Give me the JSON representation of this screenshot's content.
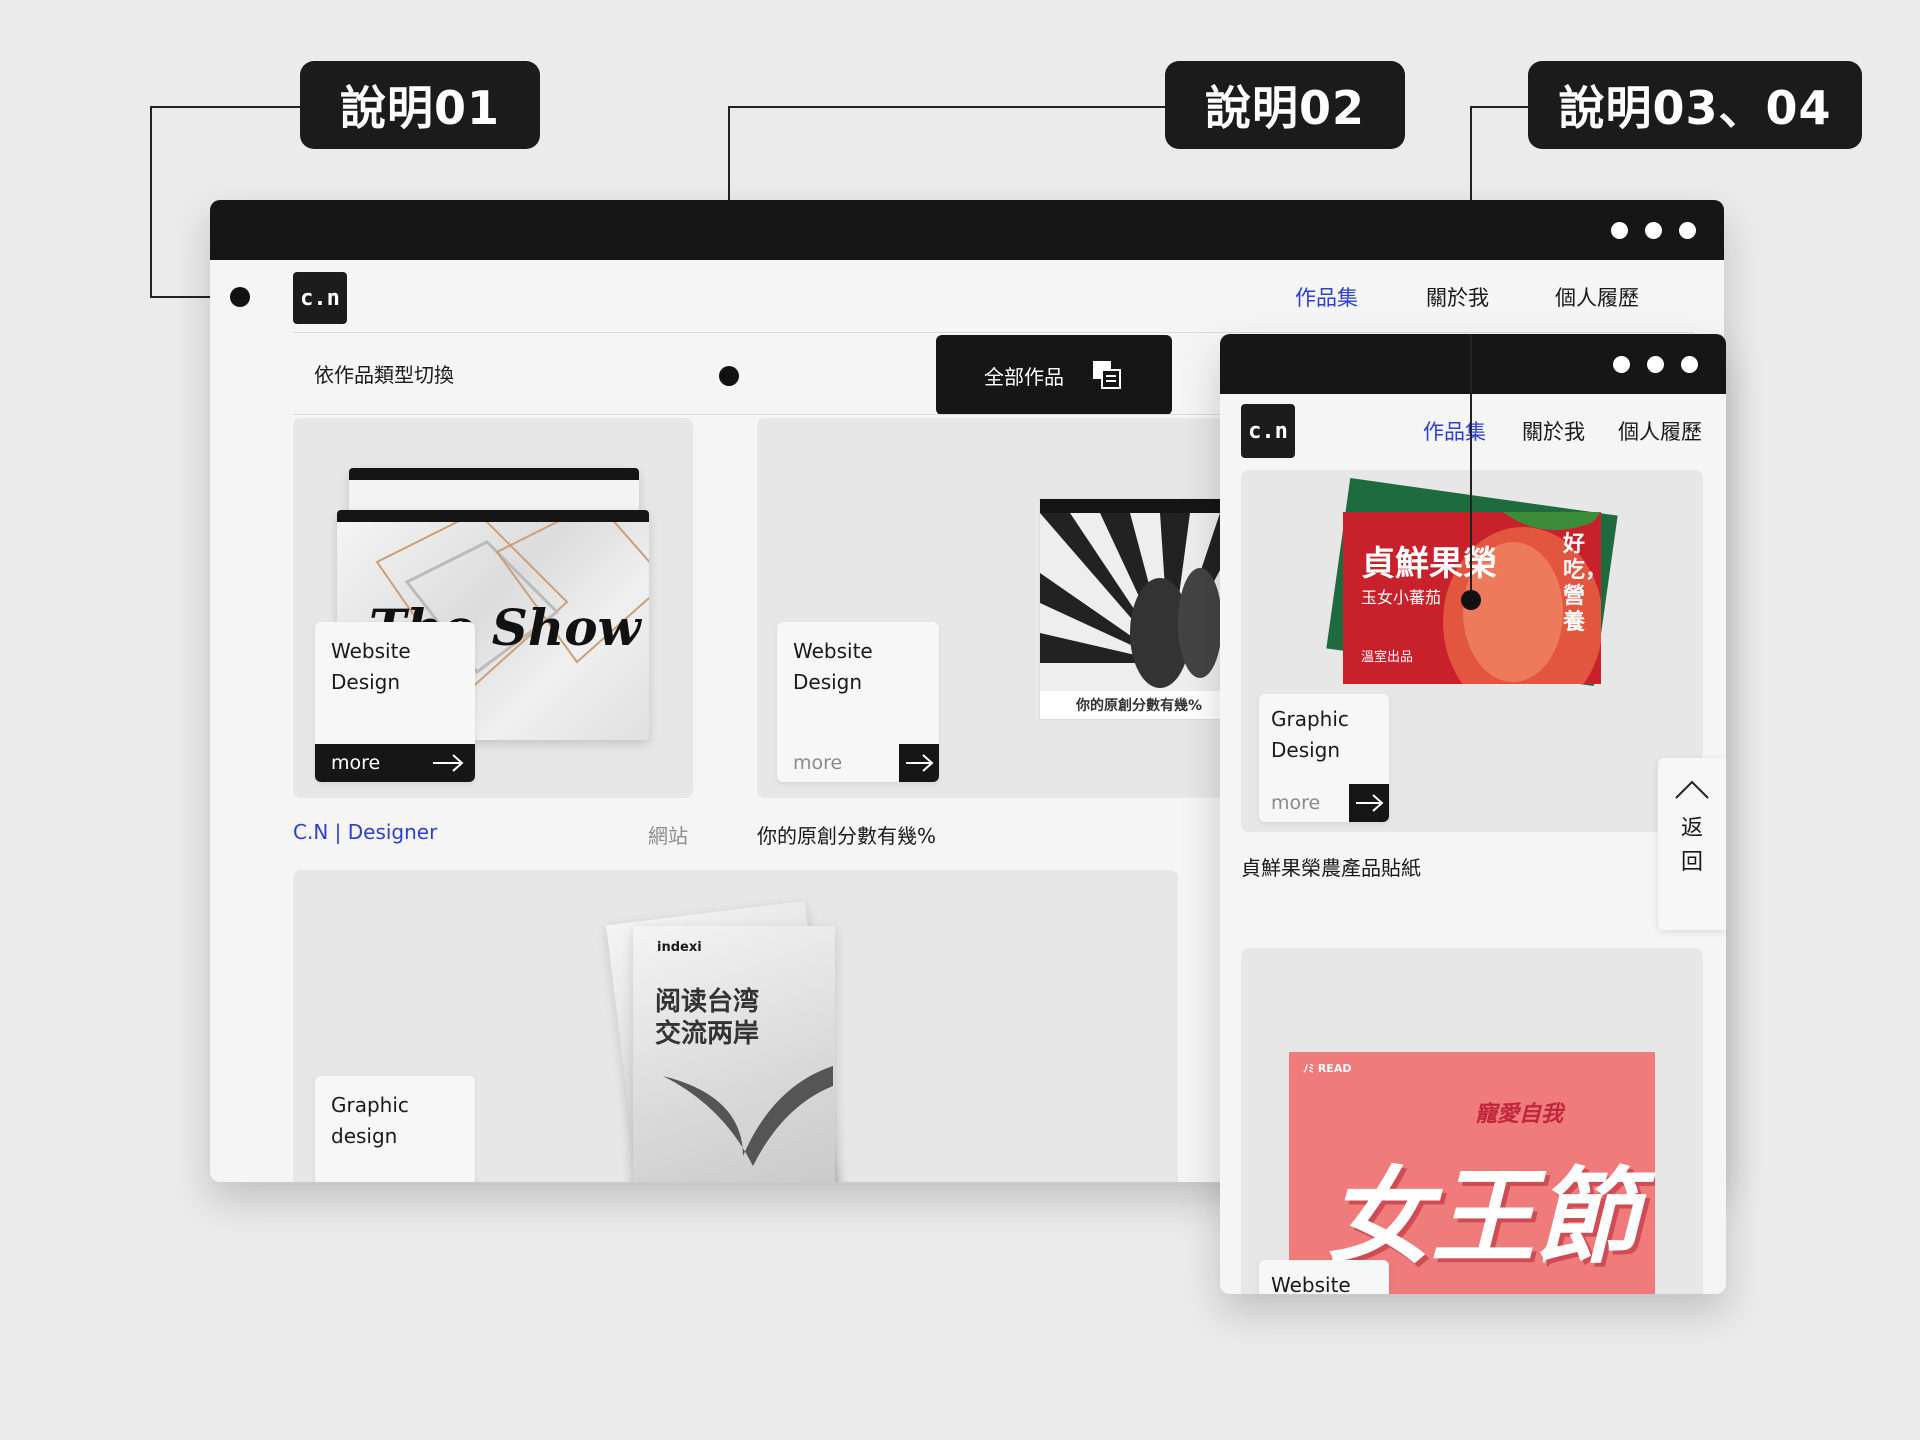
{
  "callouts": {
    "c1": "說明01",
    "c2": "說明02",
    "c3": "說明03、04"
  },
  "desktop": {
    "logo": "c.n",
    "nav": [
      "作品集",
      "關於我",
      "個人履歷"
    ],
    "filter_label": "依作品類型切換",
    "filter_button": "全部作品",
    "cards": [
      {
        "tag": "Website Design",
        "more": "more",
        "caption": "C.N | Designer",
        "category": "網站",
        "thumb_text": "The Show",
        "more_active": true
      },
      {
        "tag": "Website Design",
        "more": "more",
        "caption": "你的原創分數有幾%",
        "poster_text": "你的原創分數有幾%",
        "more_active": false
      },
      {
        "tag": "Graphic design",
        "book_brand": "indexi",
        "book_title": "阅读台湾 交流两岸"
      }
    ]
  },
  "mobile": {
    "logo": "c.n",
    "nav": [
      "作品集",
      "關於我",
      "個人履歷"
    ],
    "card1": {
      "tag": "Graphic Design",
      "more": "more",
      "caption": "貞鮮果榮農產品貼紙",
      "sticker_title": "貞鮮果榮",
      "sticker_sub": "玉女小蕃茄",
      "sticker_side": "好吃，營養",
      "sticker_foot": "溫室出品"
    },
    "card2": {
      "tag": "Website",
      "poster_brand": "ﾉﾐ READ",
      "poster_title": "女王節",
      "poster_sub": "寵愛自我"
    },
    "back_label": "返回"
  },
  "colors": {
    "accent_blue": "#2c3fd1",
    "dark": "#161616",
    "page_bg": "#ebebeb"
  }
}
